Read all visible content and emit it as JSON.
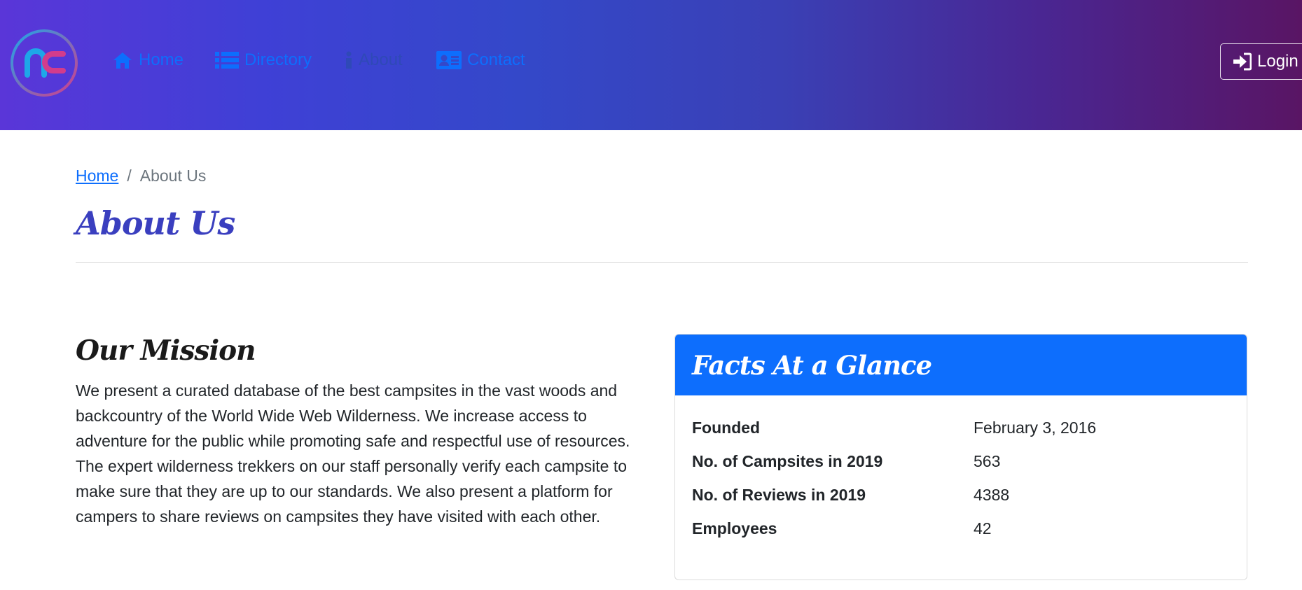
{
  "nav": {
    "items": [
      {
        "label": "Home",
        "icon": "home-icon"
      },
      {
        "label": "Directory",
        "icon": "list-icon"
      },
      {
        "label": "About",
        "icon": "info-icon"
      },
      {
        "label": "Contact",
        "icon": "address-card-icon"
      }
    ],
    "login_label": "Login",
    "login_icon": "sign-in-icon",
    "colors": {
      "link": "#0d6efd",
      "active": "#2f49b7"
    }
  },
  "breadcrumb": {
    "home": "Home",
    "separator": "/",
    "current": "About Us"
  },
  "page_title": "About Us",
  "mission": {
    "heading": "Our Mission",
    "text": "We present a curated database of the best campsites in the vast woods and backcountry of the World Wide Web Wilderness. We increase access to adventure for the public while promoting safe and respectful use of resources. The expert wilderness trekkers on our staff personally verify each campsite to make sure that they are up to our standards. We also present a platform for campers to share reviews on campsites they have visited with each other."
  },
  "facts": {
    "title": "Facts At a Glance",
    "header_color": "#0d6efd",
    "rows": [
      {
        "label": "Founded",
        "value": "February 3, 2016"
      },
      {
        "label": "No. of Campsites in 2019",
        "value": "563"
      },
      {
        "label": "No. of Reviews in 2019",
        "value": "4388"
      },
      {
        "label": "Employees",
        "value": "42"
      }
    ]
  }
}
